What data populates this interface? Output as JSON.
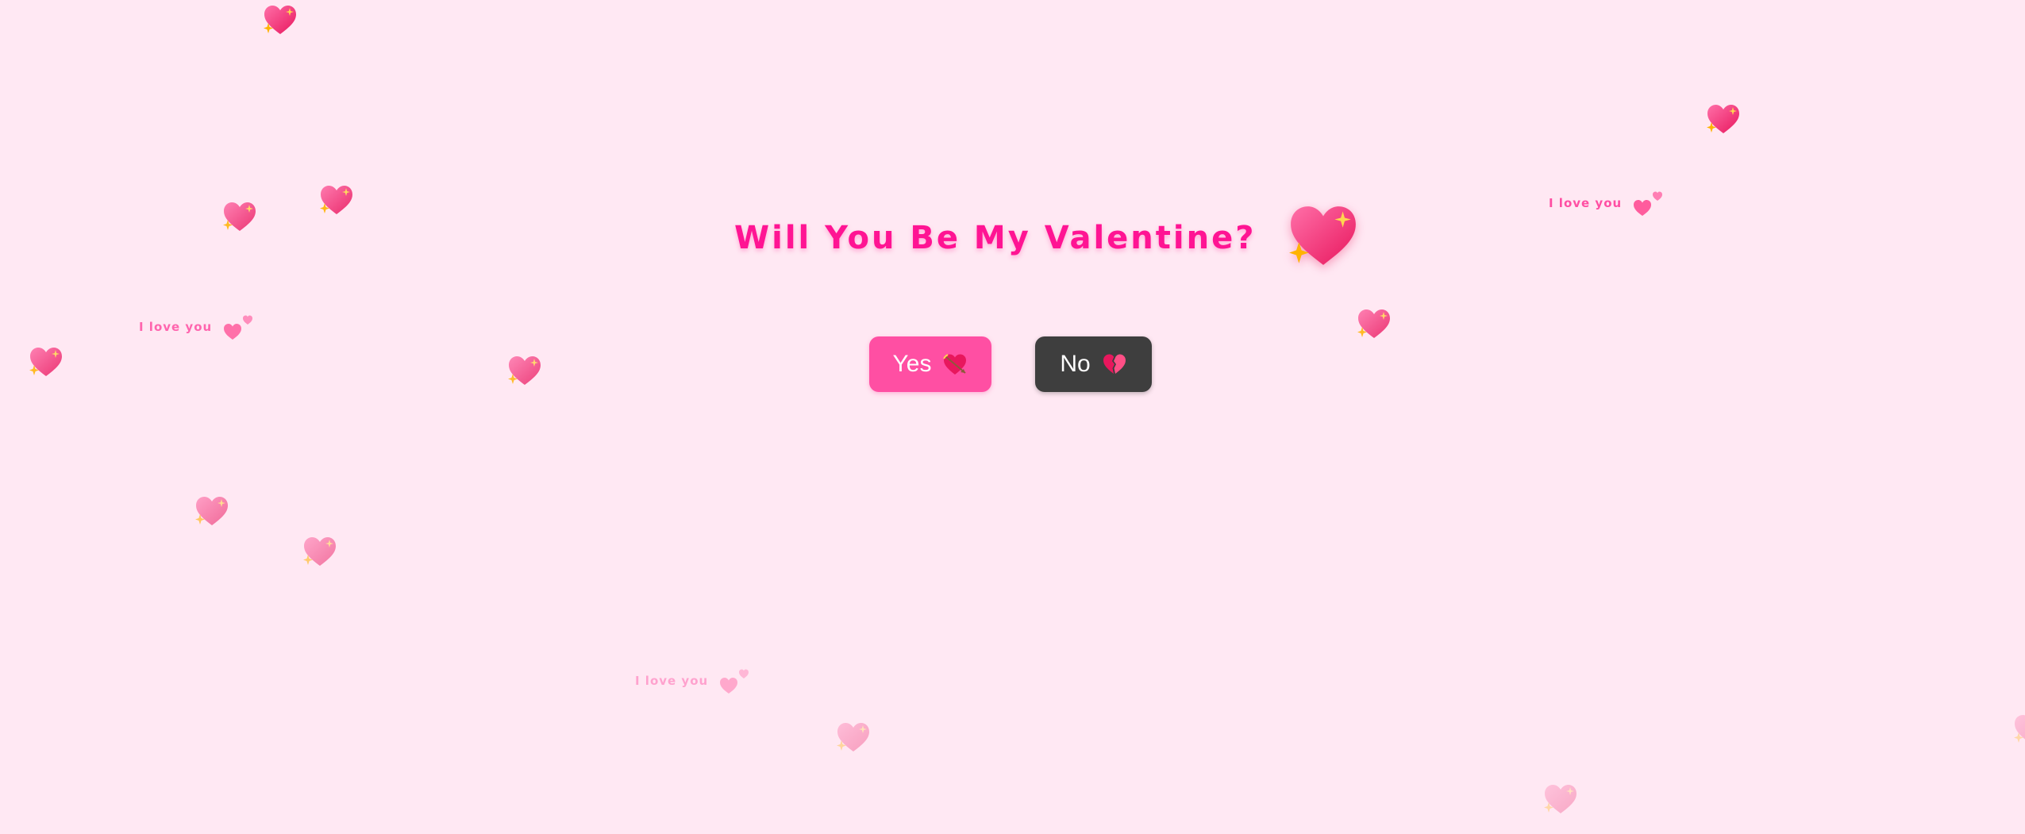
{
  "page": {
    "title": "Will You Be My Valentine?",
    "title_icon": "sparkling-heart-icon",
    "accent_color": "#ff1493",
    "background_color": "#ffe8f3"
  },
  "buttons": {
    "yes": {
      "label": "Yes",
      "icon": "heart-with-arrow-icon",
      "color": "#ff4fa3"
    },
    "no": {
      "label": "No",
      "icon": "broken-heart-icon",
      "color": "#3e3e3e"
    }
  },
  "floating_notes": [
    {
      "text": "I love you"
    },
    {
      "text": "I love you"
    },
    {
      "text": "I love you"
    }
  ]
}
